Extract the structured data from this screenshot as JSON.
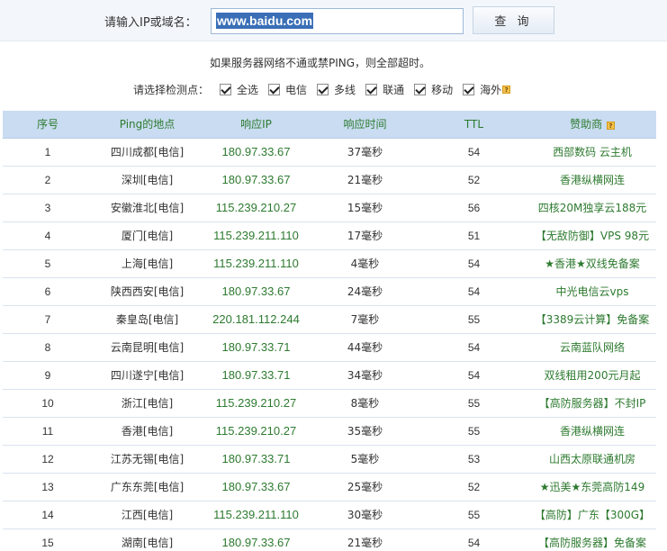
{
  "query": {
    "label": "请输入IP或域名：",
    "value": "www.baidu.com",
    "button": "查 询"
  },
  "note": "如果服务器网络不通或禁PING，则全部超时。",
  "filters": {
    "label": "请选择检测点：",
    "items": [
      {
        "label": "全选",
        "checked": true
      },
      {
        "label": "电信",
        "checked": true
      },
      {
        "label": "多线",
        "checked": true
      },
      {
        "label": "联通",
        "checked": true
      },
      {
        "label": "移动",
        "checked": true
      },
      {
        "label": "海外",
        "checked": true
      }
    ]
  },
  "table": {
    "headers": [
      "序号",
      "Ping的地点",
      "响应IP",
      "响应时间",
      "TTL",
      "赞助商"
    ],
    "rows": [
      {
        "n": "1",
        "loc": "四川成都[电信]",
        "ip": "180.97.33.67",
        "time": "37毫秒",
        "ttl": "54",
        "sponsor": "西部数码 云主机"
      },
      {
        "n": "2",
        "loc": "深圳[电信]",
        "ip": "180.97.33.67",
        "time": "21毫秒",
        "ttl": "52",
        "sponsor": "香港纵横网连"
      },
      {
        "n": "3",
        "loc": "安徽淮北[电信]",
        "ip": "115.239.210.27",
        "time": "15毫秒",
        "ttl": "56",
        "sponsor": "四核20M独享云188元"
      },
      {
        "n": "4",
        "loc": "厦门[电信]",
        "ip": "115.239.211.110",
        "time": "17毫秒",
        "ttl": "51",
        "sponsor": "【无敌防御】VPS 98元"
      },
      {
        "n": "5",
        "loc": "上海[电信]",
        "ip": "115.239.211.110",
        "time": "4毫秒",
        "ttl": "54",
        "sponsor": "★香港★双线免备案"
      },
      {
        "n": "6",
        "loc": "陕西西安[电信]",
        "ip": "180.97.33.67",
        "time": "24毫秒",
        "ttl": "54",
        "sponsor": "中光电信云vps"
      },
      {
        "n": "7",
        "loc": "秦皇岛[电信]",
        "ip": "220.181.112.244",
        "time": "7毫秒",
        "ttl": "55",
        "sponsor": "【3389云计算】免备案"
      },
      {
        "n": "8",
        "loc": "云南昆明[电信]",
        "ip": "180.97.33.71",
        "time": "44毫秒",
        "ttl": "54",
        "sponsor": "云南蓝队网络"
      },
      {
        "n": "9",
        "loc": "四川遂宁[电信]",
        "ip": "180.97.33.71",
        "time": "34毫秒",
        "ttl": "54",
        "sponsor": "双线租用200元月起"
      },
      {
        "n": "10",
        "loc": "浙江[电信]",
        "ip": "115.239.210.27",
        "time": "8毫秒",
        "ttl": "55",
        "sponsor": "【高防服务器】不封IP"
      },
      {
        "n": "11",
        "loc": "香港[电信]",
        "ip": "115.239.210.27",
        "time": "35毫秒",
        "ttl": "55",
        "sponsor": "香港纵横网连"
      },
      {
        "n": "12",
        "loc": "江苏无锡[电信]",
        "ip": "180.97.33.71",
        "time": "5毫秒",
        "ttl": "53",
        "sponsor": "山西太原联通机房"
      },
      {
        "n": "13",
        "loc": "广东东莞[电信]",
        "ip": "180.97.33.67",
        "time": "25毫秒",
        "ttl": "52",
        "sponsor": "★迅美★东莞高防149"
      },
      {
        "n": "14",
        "loc": "江西[电信]",
        "ip": "115.239.211.110",
        "time": "30毫秒",
        "ttl": "55",
        "sponsor": "【高防】广东【300G】"
      },
      {
        "n": "15",
        "loc": "湖南[电信]",
        "ip": "180.97.33.67",
        "time": "21毫秒",
        "ttl": "54",
        "sponsor": "【高防服务器】免备案"
      }
    ]
  },
  "colors": {
    "header_bg": "#c9dcf1",
    "accent_green": "#2d7a2f",
    "topbar_bg": "#f3f7fb"
  }
}
